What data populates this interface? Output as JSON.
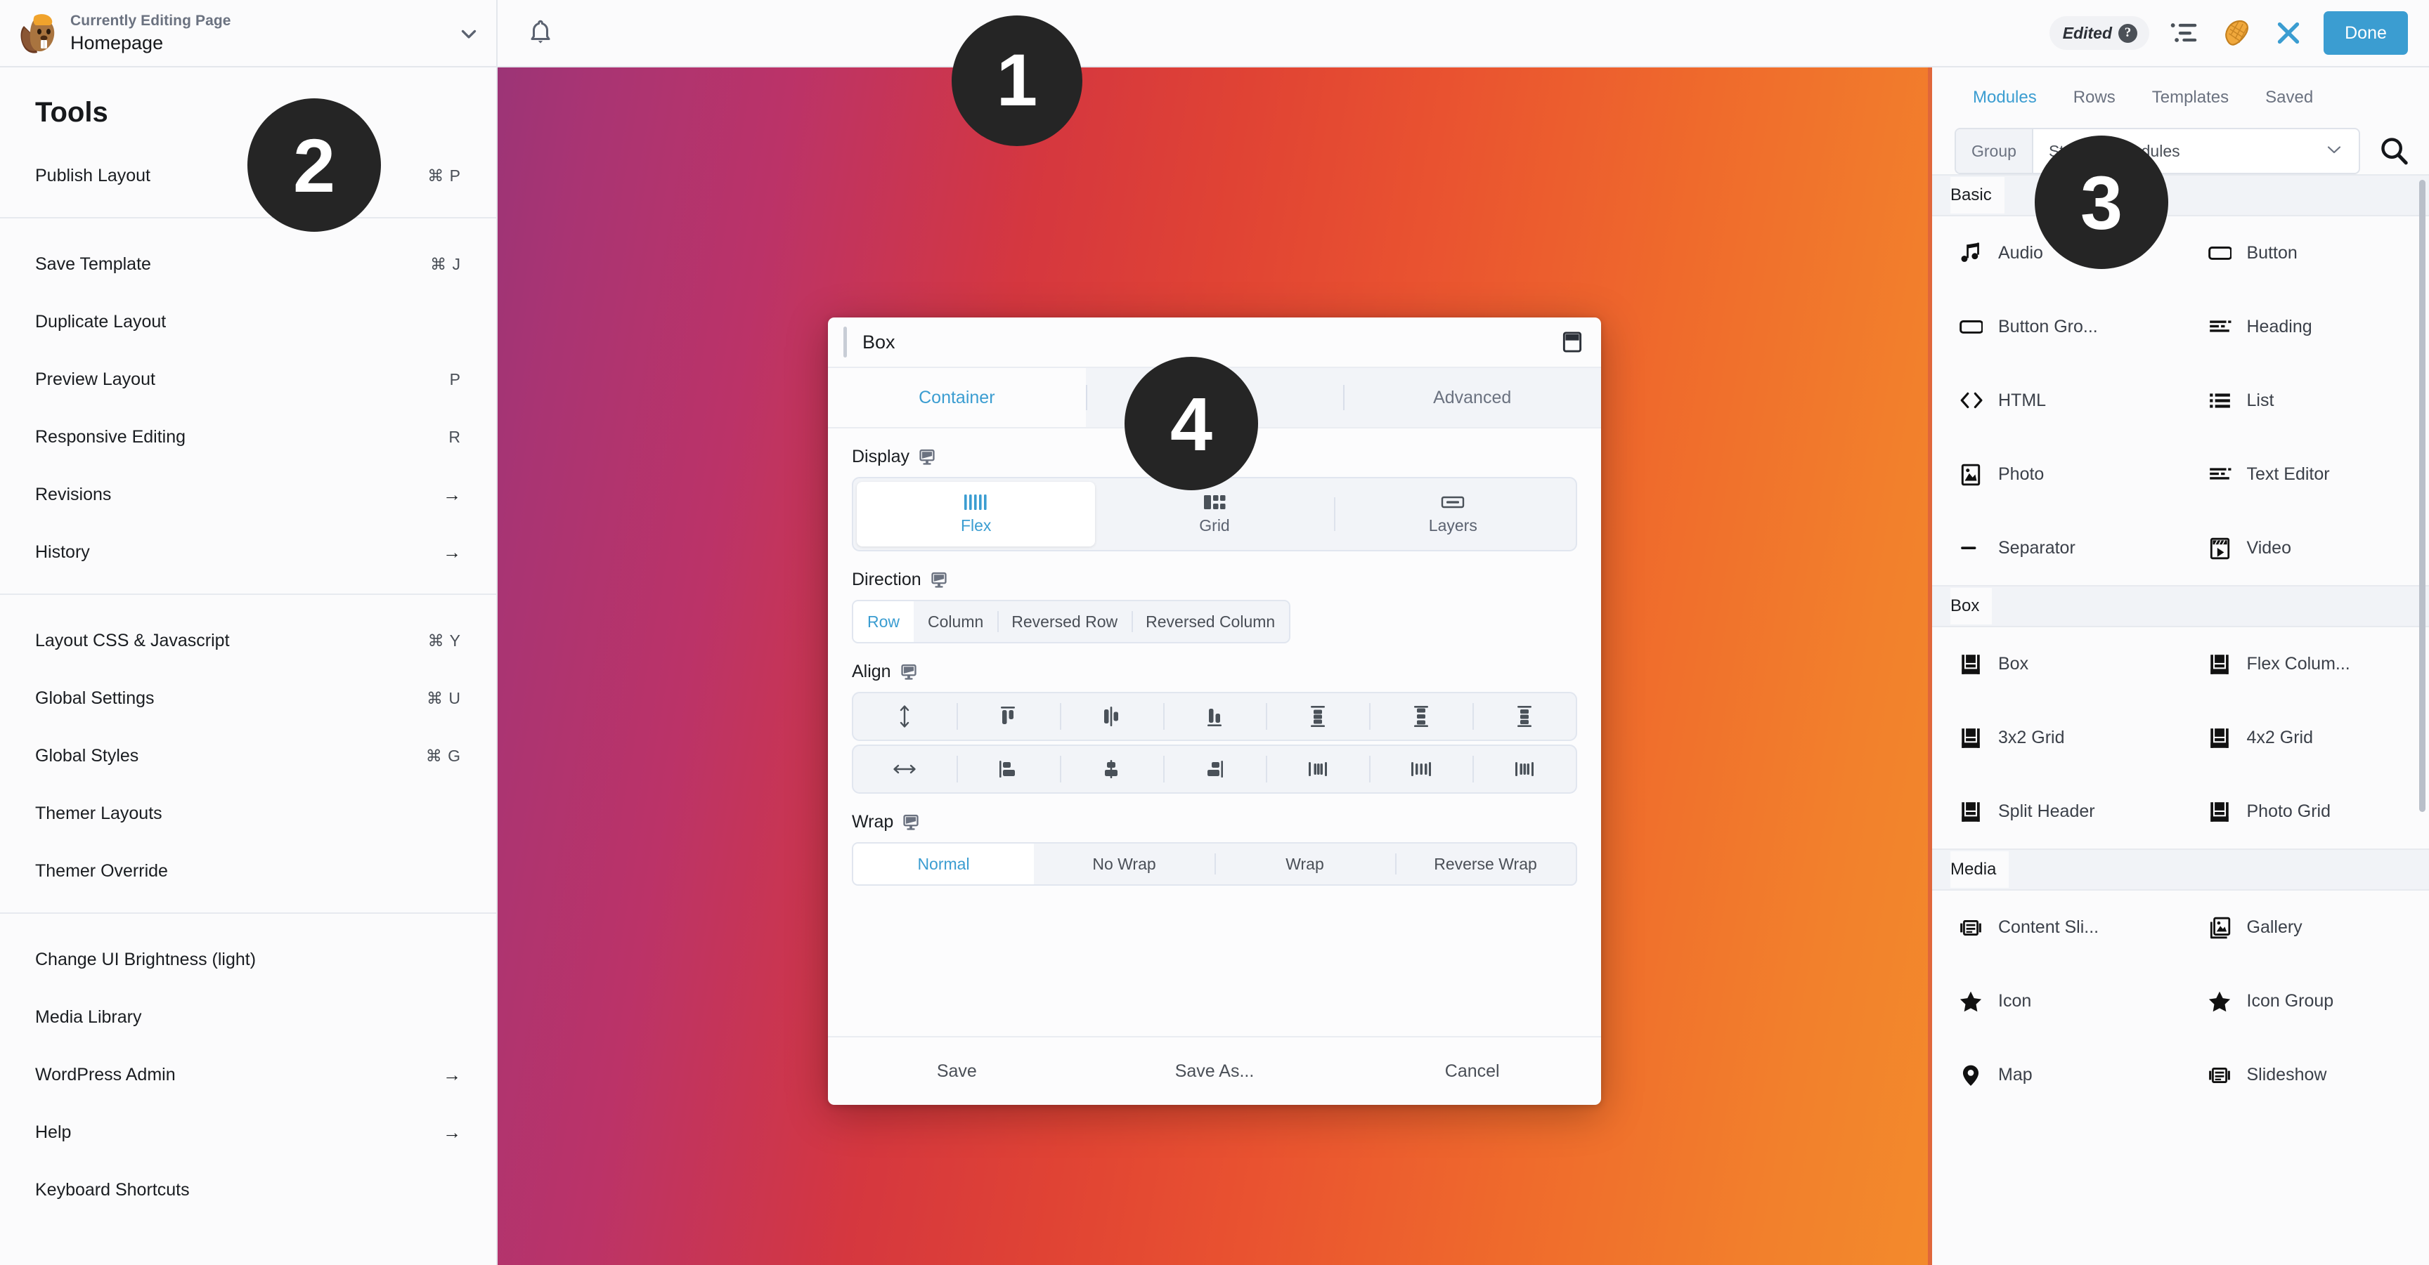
{
  "topbar": {
    "eyebrow": "Currently Editing Page",
    "page_title": "Homepage",
    "chevron_icon": "chevron-down-icon",
    "bell_icon": "bell-icon",
    "edited_label": "Edited",
    "help_glyph": "?",
    "outline_icon": "outline-list-icon",
    "tools_icon": "beaver-tail-icon",
    "close_icon": "close-x-icon",
    "done_label": "Done",
    "accent_blue": "#3b9dd1"
  },
  "sidebar": {
    "heading": "Tools",
    "groups": [
      {
        "items": [
          {
            "label": "Publish Layout",
            "accel": "⌘ P"
          }
        ]
      },
      {
        "items": [
          {
            "label": "Save Template",
            "accel": "⌘ J"
          },
          {
            "label": "Duplicate Layout",
            "accel": ""
          },
          {
            "label": "Preview Layout",
            "accel": "P"
          },
          {
            "label": "Responsive Editing",
            "accel": "R"
          },
          {
            "label": "Revisions",
            "accel": "→"
          },
          {
            "label": "History",
            "accel": "→"
          }
        ]
      },
      {
        "items": [
          {
            "label": "Layout CSS & Javascript",
            "accel": "⌘ Y"
          },
          {
            "label": "Global Settings",
            "accel": "⌘ U"
          },
          {
            "label": "Global Styles",
            "accel": "⌘ G"
          },
          {
            "label": "Themer Layouts",
            "accel": ""
          },
          {
            "label": "Themer Override",
            "accel": ""
          }
        ]
      },
      {
        "items": [
          {
            "label": "Change UI Brightness (light)",
            "accel": ""
          },
          {
            "label": "Media Library",
            "accel": ""
          },
          {
            "label": "WordPress Admin",
            "accel": "→"
          },
          {
            "label": "Help",
            "accel": "→"
          },
          {
            "label": "Keyboard Shortcuts",
            "accel": ""
          }
        ]
      }
    ]
  },
  "dialog": {
    "title": "Box",
    "expand_icon": "expand-panel-icon",
    "tabs": [
      {
        "label": "Container",
        "active": true
      },
      {
        "label": "",
        "active": false
      },
      {
        "label": "Advanced",
        "active": false
      }
    ],
    "fields": [
      {
        "label": "Display",
        "responsive_icon": "monitor-icon",
        "type": "segment-icon",
        "options": [
          {
            "label": "Flex",
            "icon": "flex-bars-icon",
            "selected": true
          },
          {
            "label": "Grid",
            "icon": "grid-blocks-icon",
            "selected": false
          },
          {
            "label": "Layers",
            "icon": "layers-bar-icon",
            "selected": false
          }
        ]
      },
      {
        "label": "Direction",
        "responsive_icon": "monitor-icon",
        "type": "segment-text",
        "options": [
          {
            "label": "Row",
            "selected": true
          },
          {
            "label": "Column",
            "selected": false
          },
          {
            "label": "Reversed Row",
            "selected": false
          },
          {
            "label": "Reversed Column",
            "selected": false
          }
        ]
      },
      {
        "label": "Align",
        "responsive_icon": "monitor-icon",
        "type": "align-grid",
        "rows": [
          [
            "align-stretch-vertical",
            "align-top",
            "align-middle",
            "align-bottom",
            "align-space-between-vertical",
            "align-space-around-vertical",
            "align-space-evenly-vertical"
          ],
          [
            "align-stretch-horizontal",
            "align-left",
            "align-center",
            "align-right",
            "align-space-between-horizontal",
            "align-space-around-horizontal",
            "align-space-evenly-horizontal"
          ]
        ]
      },
      {
        "label": "Wrap",
        "responsive_icon": "monitor-icon",
        "type": "segment-text-full",
        "options": [
          {
            "label": "Normal",
            "selected": true
          },
          {
            "label": "No Wrap",
            "selected": false
          },
          {
            "label": "Wrap",
            "selected": false
          },
          {
            "label": "Reverse Wrap",
            "selected": false
          }
        ]
      }
    ],
    "footer": [
      {
        "label": "Save"
      },
      {
        "label": "Save As..."
      },
      {
        "label": "Cancel"
      }
    ]
  },
  "right_panel": {
    "accent_bar": "#e0663a",
    "tabs": [
      {
        "label": "Modules",
        "active": true
      },
      {
        "label": "Rows",
        "active": false
      },
      {
        "label": "Templates",
        "active": false
      },
      {
        "label": "Saved",
        "active": false
      }
    ],
    "filter": {
      "group_label": "Group",
      "selected_value": "Standard Modules",
      "chevron_icon": "chevron-down-icon",
      "search_icon": "search-icon"
    },
    "sections": [
      {
        "title": "Basic",
        "items": [
          {
            "label": "Audio",
            "icon": "music-note-icon"
          },
          {
            "label": "Button",
            "icon": "button-rect-icon"
          },
          {
            "label": "Button Gro...",
            "icon": "button-rect-icon"
          },
          {
            "label": "Heading",
            "icon": "heading-lines-icon"
          },
          {
            "label": "HTML",
            "icon": "code-brackets-icon"
          },
          {
            "label": "List",
            "icon": "bullet-list-icon"
          },
          {
            "label": "Photo",
            "icon": "photo-icon"
          },
          {
            "label": "Text Editor",
            "icon": "text-lines-icon"
          },
          {
            "label": "Separator",
            "icon": "separator-dash-icon"
          },
          {
            "label": "Video",
            "icon": "video-play-icon"
          }
        ]
      },
      {
        "title": "Box",
        "items": [
          {
            "label": "Box",
            "icon": "layout-box-icon"
          },
          {
            "label": "Flex Colum...",
            "icon": "layout-box-icon"
          },
          {
            "label": "3x2 Grid",
            "icon": "layout-box-icon"
          },
          {
            "label": "4x2 Grid",
            "icon": "layout-box-icon"
          },
          {
            "label": "Split Header",
            "icon": "layout-box-icon"
          },
          {
            "label": "Photo Grid",
            "icon": "layout-box-icon"
          }
        ]
      },
      {
        "title": "Media",
        "items": [
          {
            "label": "Content Sli...",
            "icon": "content-slider-icon"
          },
          {
            "label": "Gallery",
            "icon": "gallery-stack-icon"
          },
          {
            "label": "Icon",
            "icon": "star-icon"
          },
          {
            "label": "Icon Group",
            "icon": "star-icon"
          },
          {
            "label": "Map",
            "icon": "map-pin-icon"
          },
          {
            "label": "Slideshow",
            "icon": "content-slider-icon"
          }
        ]
      }
    ]
  },
  "markers": {
    "m1": "1",
    "m2": "2",
    "m3": "3",
    "m4": "4"
  }
}
